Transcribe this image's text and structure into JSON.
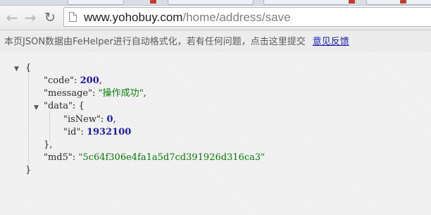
{
  "browser": {
    "url_host": "www.yohobuy.com",
    "url_path": "/home/address/save"
  },
  "notice": {
    "text": "本页JSON数据由FeHelper进行自动格式化，若有任何问题，点击这里提交",
    "feedback_link": "意见反馈"
  },
  "json": {
    "open_brace": "{",
    "close_brace": "}",
    "code": {
      "key": "\"code\"",
      "value": "200"
    },
    "message": {
      "key": "\"message\"",
      "value": "\"操作成功\""
    },
    "data": {
      "key": "\"data\"",
      "open": "{",
      "close": "},",
      "isNew": {
        "key": "\"isNew\"",
        "value": "0"
      },
      "id": {
        "key": "\"id\"",
        "value": "1932100"
      }
    },
    "md5": {
      "key": "\"md5\"",
      "value": "\"5c64f306e4fa1a5d7cd391926d316ca3\""
    }
  }
}
